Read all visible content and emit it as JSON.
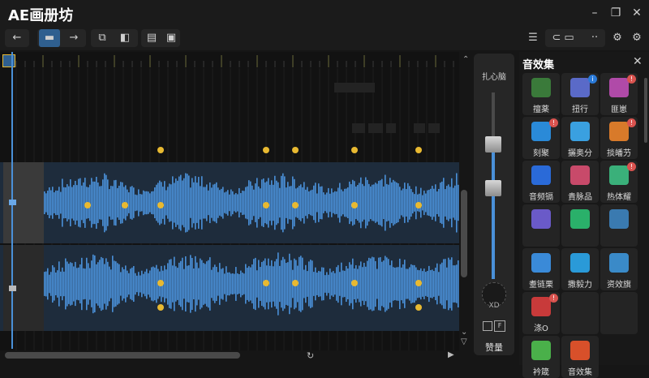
{
  "app": {
    "title": "AE画册坊"
  },
  "window": {
    "icons": [
      "minimize-icon",
      "restore-icon",
      "close-icon"
    ]
  },
  "toolbar": {
    "icons": [
      "back-arrow-icon",
      "select-tool-icon",
      "forward-arrow-icon",
      "crop-icon",
      "split-icon",
      "copy-icon",
      "paste-icon",
      "menu-icon",
      "toggle-icon",
      "more-icon",
      "settings-icon",
      "gear-icon"
    ]
  },
  "volume": {
    "label": "扎心脑",
    "pan_label": "XD",
    "check_label": "F",
    "bottom_label": "赞量"
  },
  "effects_panel": {
    "title": "音效集",
    "items": [
      {
        "label": "擅薬",
        "icon": "chart-icon",
        "badge": ""
      },
      {
        "label": "扭行",
        "icon": "cube-icon",
        "badge": "i"
      },
      {
        "label": "匪崽",
        "icon": "gem-icon",
        "badge": "!"
      },
      {
        "label": "刻聚",
        "icon": "monitor-icon",
        "badge": "!"
      },
      {
        "label": "攦奥分",
        "icon": "display-icon",
        "badge": ""
      },
      {
        "label": "掞皤芀",
        "icon": "rocket-icon",
        "badge": "!"
      },
      {
        "label": "音频镉",
        "icon": "download-icon",
        "badge": ""
      },
      {
        "label": "貴脉品",
        "icon": "puzzle-icon",
        "badge": ""
      },
      {
        "label": "热体耀",
        "icon": "layers-icon",
        "badge": "!"
      },
      {
        "label": "",
        "icon": "box-icon",
        "badge": ""
      },
      {
        "label": "",
        "icon": "pie-icon",
        "badge": ""
      },
      {
        "label": "",
        "icon": "cross-icon",
        "badge": ""
      },
      {
        "label": "耋链栗",
        "icon": "diamond-icon",
        "badge": ""
      },
      {
        "label": "撒毅力",
        "icon": "prism-icon",
        "badge": ""
      },
      {
        "label": "资效旗",
        "icon": "network-icon",
        "badge": ""
      },
      {
        "label": "涤O",
        "icon": "brush-icon",
        "badge": "!"
      },
      {
        "label": "",
        "icon": "",
        "badge": ""
      },
      {
        "label": "",
        "icon": "",
        "badge": ""
      },
      {
        "label": "衿箴",
        "icon": "equalizer-icon",
        "badge": ""
      },
      {
        "label": "音效集",
        "icon": "flame-icon",
        "badge": ""
      }
    ]
  },
  "colors": {
    "accent": "#4a90d8",
    "keyframe": "#e8b931",
    "badge": "#d9534f"
  }
}
